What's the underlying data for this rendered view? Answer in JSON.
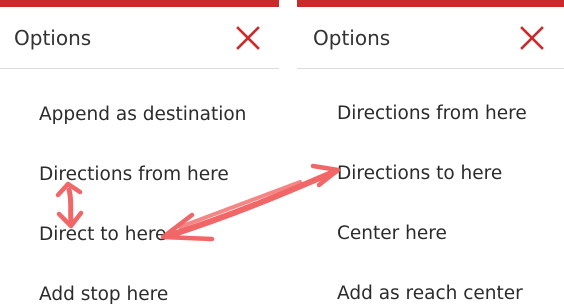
{
  "left_panel": {
    "title": "Options",
    "close_icon": "close-icon",
    "items": [
      {
        "label": "Append as destination"
      },
      {
        "label": "Directions from here"
      },
      {
        "label": "Direct to here"
      },
      {
        "label": "Add stop here"
      }
    ]
  },
  "right_panel": {
    "title": "Options",
    "close_icon": "close-icon",
    "items": [
      {
        "label": "Directions from here"
      },
      {
        "label": "Directions to here"
      },
      {
        "label": "Center here"
      },
      {
        "label": "Add as reach center"
      }
    ]
  },
  "colors": {
    "accent_bar": "#cc2a2a",
    "close_icon": "#cc2a2a",
    "annotation_arrow": "#f05a5a"
  }
}
